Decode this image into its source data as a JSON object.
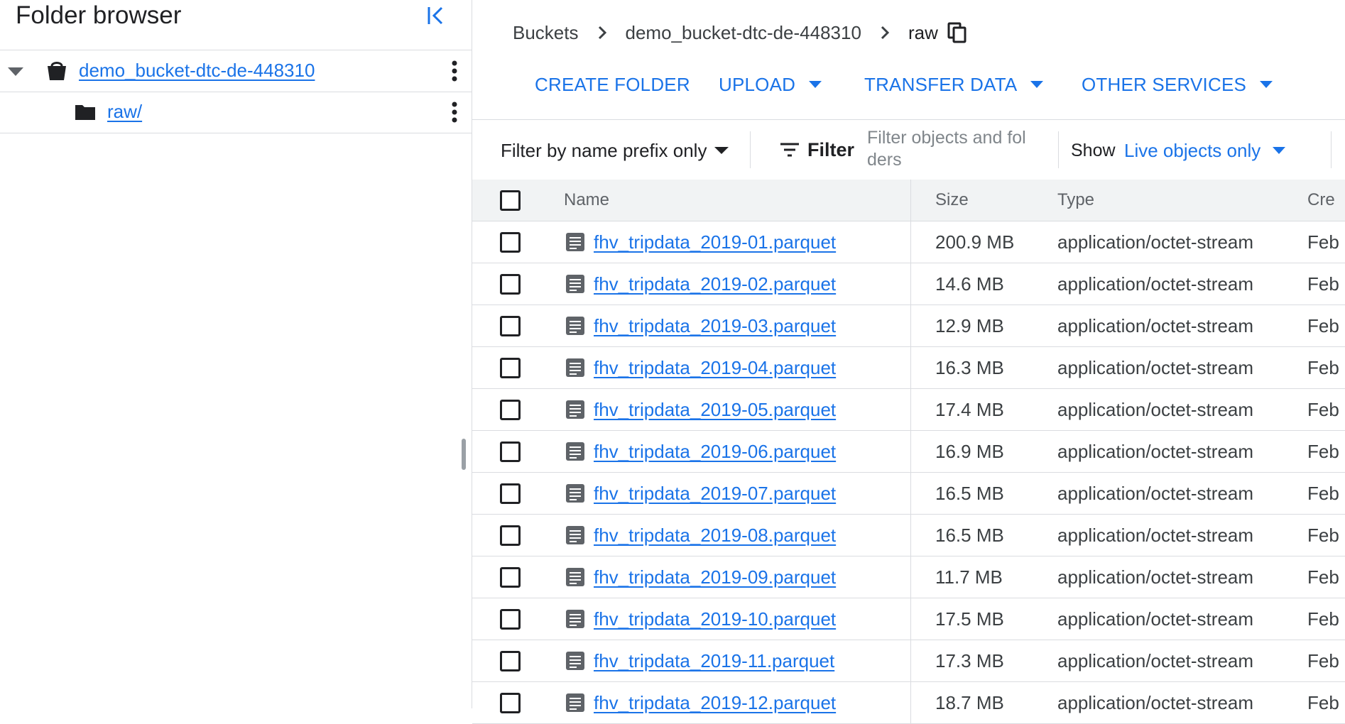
{
  "sidebar": {
    "title": "Folder browser",
    "bucket": {
      "label": "demo_bucket-dtc-de-448310"
    },
    "folder": {
      "label": "raw/"
    }
  },
  "breadcrumb": {
    "items": [
      "Buckets",
      "demo_bucket-dtc-de-448310"
    ],
    "current": "raw"
  },
  "actions": {
    "create_folder": "CREATE FOLDER",
    "upload": "UPLOAD",
    "transfer_data": "TRANSFER DATA",
    "other_services": "OTHER SERVICES"
  },
  "toolbar": {
    "prefix_mode": "Filter by name prefix only",
    "filter_label": "Filter",
    "filter_placeholder": "Filter objects and fol ders",
    "show_label": "Show",
    "show_value": "Live objects only"
  },
  "table": {
    "columns": {
      "name": "Name",
      "size": "Size",
      "type": "Type",
      "created": "Cre"
    },
    "rows": [
      {
        "name": "fhv_tripdata_2019-01.parquet",
        "size": "200.9 MB",
        "type": "application/octet-stream",
        "created": "Feb"
      },
      {
        "name": "fhv_tripdata_2019-02.parquet",
        "size": "14.6 MB",
        "type": "application/octet-stream",
        "created": "Feb"
      },
      {
        "name": "fhv_tripdata_2019-03.parquet",
        "size": "12.9 MB",
        "type": "application/octet-stream",
        "created": "Feb"
      },
      {
        "name": "fhv_tripdata_2019-04.parquet",
        "size": "16.3 MB",
        "type": "application/octet-stream",
        "created": "Feb"
      },
      {
        "name": "fhv_tripdata_2019-05.parquet",
        "size": "17.4 MB",
        "type": "application/octet-stream",
        "created": "Feb"
      },
      {
        "name": "fhv_tripdata_2019-06.parquet",
        "size": "16.9 MB",
        "type": "application/octet-stream",
        "created": "Feb"
      },
      {
        "name": "fhv_tripdata_2019-07.parquet",
        "size": "16.5 MB",
        "type": "application/octet-stream",
        "created": "Feb"
      },
      {
        "name": "fhv_tripdata_2019-08.parquet",
        "size": "16.5 MB",
        "type": "application/octet-stream",
        "created": "Feb"
      },
      {
        "name": "fhv_tripdata_2019-09.parquet",
        "size": "11.7 MB",
        "type": "application/octet-stream",
        "created": "Feb"
      },
      {
        "name": "fhv_tripdata_2019-10.parquet",
        "size": "17.5 MB",
        "type": "application/octet-stream",
        "created": "Feb"
      },
      {
        "name": "fhv_tripdata_2019-11.parquet",
        "size": "17.3 MB",
        "type": "application/octet-stream",
        "created": "Feb"
      },
      {
        "name": "fhv_tripdata_2019-12.parquet",
        "size": "18.7 MB",
        "type": "application/octet-stream",
        "created": "Feb"
      }
    ]
  },
  "colors": {
    "accent": "#1a73e8",
    "text": "#202124",
    "muted": "#5f6368",
    "divider": "#dadce0",
    "header_bg": "#f1f3f4",
    "icon_gray": "#5f6368"
  },
  "icons": {
    "collapse": "collapse-panel-icon",
    "caret": "caret-down-icon",
    "bucket": "bucket-icon",
    "folder": "folder-icon",
    "more": "more-vert-icon",
    "chevron": "chevron-right-icon",
    "copy": "copy-icon",
    "dropdown": "arrow-drop-down-icon",
    "filter": "filter-icon",
    "file": "file-icon"
  }
}
